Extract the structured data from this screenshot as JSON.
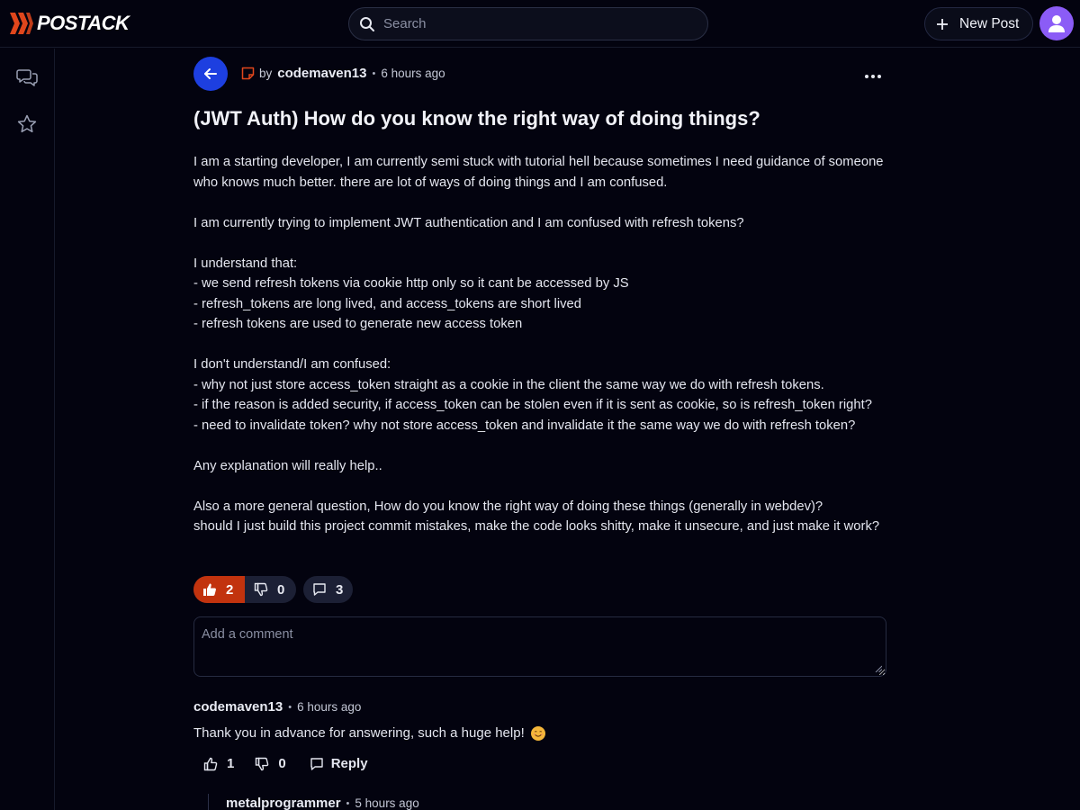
{
  "app": {
    "brand": "POSTACK",
    "accent": "#c2330e",
    "primary": "#1d3fe0",
    "avatar_color": "#8b5cf6"
  },
  "header": {
    "search_placeholder": "Search",
    "new_post_label": "New Post"
  },
  "sidebar": {
    "items": [
      {
        "icon": "chat-bubbles-icon"
      },
      {
        "icon": "star-icon"
      }
    ]
  },
  "post": {
    "by_label": "by",
    "author": "codemaven13",
    "time": "6 hours ago",
    "title": "(JWT Auth) How do you know the right way of doing things?",
    "paragraphs": [
      [
        "I am a starting developer, I am currently semi stuck with tutorial hell because sometimes I need guidance of someone who knows much better. there are lot of ways of doing things and I am confused."
      ],
      [
        "I am currently trying to implement JWT authentication and I am confused with refresh tokens?"
      ],
      [
        "I understand that:",
        "- we send refresh tokens via cookie http only so it cant be accessed by JS",
        "- refresh_tokens are long lived, and access_tokens are short lived",
        "- refresh tokens are used to generate new access token"
      ],
      [
        "I don't understand/I am confused:",
        "- why not just store access_token straight as a cookie in the client the same way we do with refresh tokens.",
        "- if the reason is added security, if access_token can be stolen even if it is sent as cookie, so is refresh_token right?",
        "- need to invalidate token? why not store access_token and invalidate it the same way we do with refresh token?"
      ],
      [
        "Any explanation will really help.."
      ],
      [
        "Also a more general question, How do you know the right way of doing these things (generally in webdev)?",
        "should I just build this project commit mistakes, make the code looks shitty, make it unsecure, and just make it work?"
      ]
    ],
    "upvotes": "2",
    "downvotes": "0",
    "comments": "3"
  },
  "comment_input": {
    "placeholder": "Add a comment"
  },
  "comments": [
    {
      "author": "codemaven13",
      "time": "6 hours ago",
      "text": "Thank you in advance for answering, such a huge help!",
      "upvotes": "1",
      "downvotes": "0",
      "reply_label": "Reply"
    },
    {
      "author": "metalprogrammer",
      "time": "5 hours ago"
    }
  ]
}
